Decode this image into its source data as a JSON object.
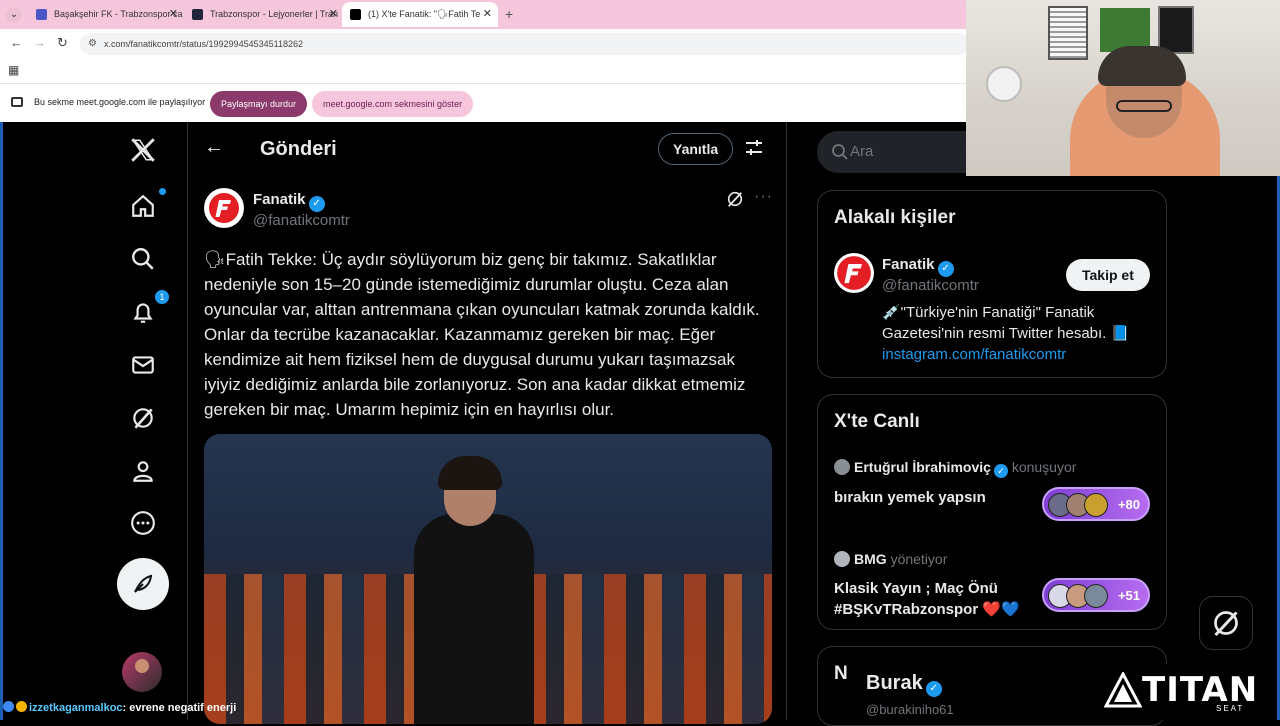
{
  "browser": {
    "tabs": [
      {
        "label": "Başakşehir FK - Trabzonspor ca",
        "favicon_color": "#4a55c8"
      },
      {
        "label": "Trabzonspor - Lejyonerler | Tran",
        "favicon_color": "#22253a"
      },
      {
        "label": "(1) X'te Fanatik: \"🗣Fatih Te",
        "favicon_color": "#000000",
        "active": true
      }
    ],
    "url": "x.com/fanatikcomtr/status/1992994545345118262",
    "share_text": "Bu sekme meet.google.com ile paylaşılıyor",
    "stop_sharing_label": "Paylaşmayı durdur",
    "show_tab_label": "meet.google.com sekmesini göster"
  },
  "x": {
    "nav": {
      "notifications_badge": "1"
    },
    "header": {
      "title": "Gönderi",
      "reply_label": "Yanıtla"
    },
    "post": {
      "author_name": "Fanatik",
      "author_handle": "@fanatikcomtr",
      "text": "🗣Fatih Tekke: Üç aydır söylüyorum biz genç bir takımız. Sakatlıklar nedeniyle son 15–20 günde istemediğimiz durumlar oluştu. Ceza alan oyuncular var, alttan antrenmana çıkan oyuncuları katmak zorunda kaldık. Onlar da tecrübe kazanacaklar. Kazanmamız gereken bir maç. Eğer kendimize ait hem fiziksel hem de duygusal durumu yukarı taşımazsak iyiyiz dediğimiz anlarda bile zorlanıyoruz. Son ana kadar dikkat etmemiz gereken bir maç. Umarım hepimiz için en hayırlısı olur."
    },
    "search": {
      "placeholder": "Ara"
    },
    "relevant": {
      "title": "Alakalı kişiler",
      "name": "Fanatik",
      "handle": "@fanatikcomtr",
      "bio": "💉\"Türkiye'nin Fanatiği\" Fanatik Gazetesi'nin resmi Twitter hesabı. 📘",
      "link": "instagram.com/fanatikcomtr",
      "follow_label": "Takip et"
    },
    "live": {
      "title": "X'te Canlı",
      "items": [
        {
          "host": "Ertuğrul İbrahimoviç",
          "role": "konuşuyor",
          "title": "bırakın yemek yapsın",
          "count": "+80"
        },
        {
          "host": "BMG",
          "role": "yönetiyor",
          "title": "Klasik Yayın ; Maç Önü #BŞKvTRabzonspor ❤️💙",
          "count": "+51"
        }
      ]
    },
    "next_card_title": "Ne",
    "popup": {
      "name": "Burak",
      "handle": "@burakiniho61"
    }
  },
  "overlay": {
    "chat_user": "izzetkaganmalkoc",
    "chat_message": ": evrene negatif enerji",
    "brand": "TITAN",
    "brand_sub": "SEAT"
  }
}
